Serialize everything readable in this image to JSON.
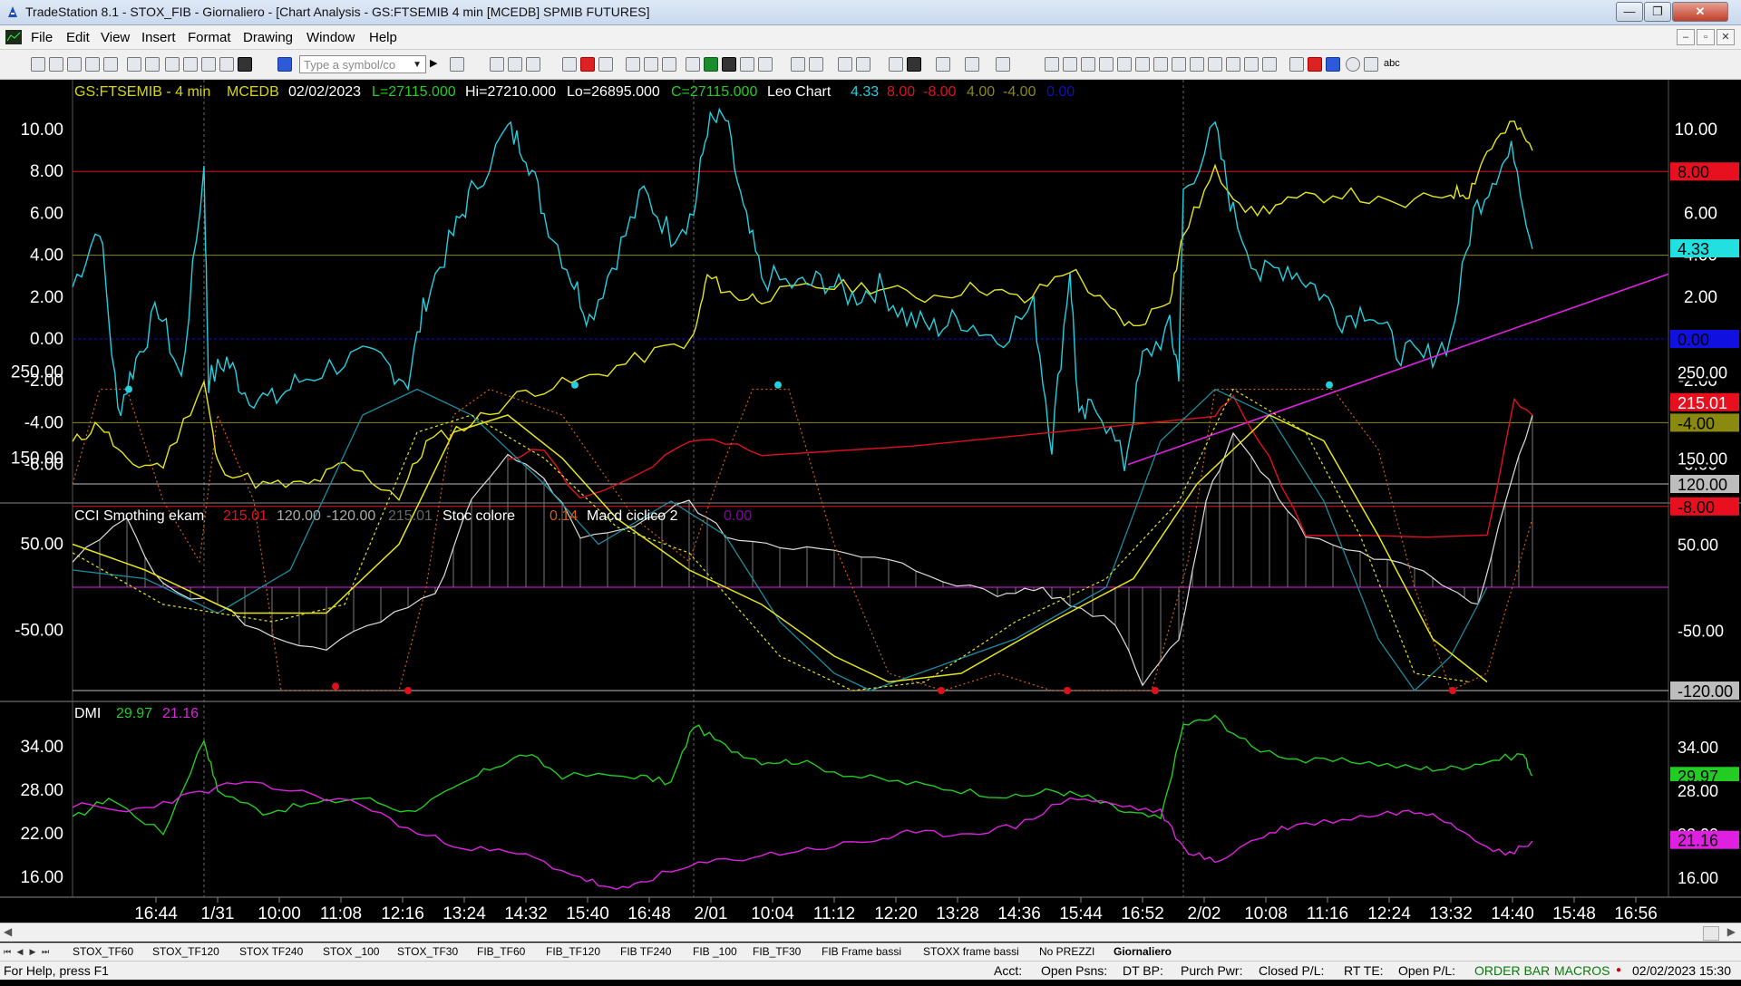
{
  "window": {
    "title": "TradeStation 8.1 - STOX_FIB - Giornaliero - [Chart Analysis - GS:FTSEMIB  4 min  [MCEDB] SPMIB FUTURES]",
    "min_label": "—",
    "max_label": "❐",
    "close_label": "✕"
  },
  "menu": [
    "File",
    "Edit",
    "View",
    "Insert",
    "Format",
    "Drawing",
    "Window",
    "Help"
  ],
  "mdi_buttons": [
    "–",
    "▫",
    "✕"
  ],
  "toolbar": {
    "symbol_placeholder": "Type a symbol/co",
    "text_tool": "abc"
  },
  "chart": {
    "header": {
      "symbol": "GS:FTSEMIB - 4 min",
      "provider": "MCEDB",
      "date": "02/02/2023",
      "last": "L=27115.000",
      "high": "Hi=27210.000",
      "low": "Lo=26895.000",
      "close": "C=27115.000",
      "indicator": "Leo Chart",
      "v1": "4.33",
      "v2": "8.00",
      "v3": "-8.00",
      "v4": "4.00",
      "v5": "-4.00",
      "v6": "0.00"
    },
    "panel2_header": {
      "name": "CCI Smothing ekam",
      "v1": "215.01",
      "v2": "120.00",
      "v3": "-120.00",
      "v4": "215.01",
      "stoc": "Stoc colore",
      "stoc_v": "0.14",
      "macd": "Macd ciclico 2",
      "macd_v": "0.00"
    },
    "panel3_header": {
      "name": "DMI",
      "v1": "29.97",
      "v2": "21.16"
    },
    "panel1_axis": [
      "10.00",
      "8.00",
      "6.00",
      "4.00",
      "2.00",
      "0.00",
      "-2.00",
      "-4.00",
      "-6.00"
    ],
    "panel2_axis": [
      "250.00",
      "150.00",
      "50.00",
      "-50.00"
    ],
    "panel3_axis": [
      "34.00",
      "28.00",
      "22.00",
      "16.00"
    ],
    "right_markers_p1": [
      {
        "label": "8.00",
        "color": "#e8101e",
        "text": "#000"
      },
      {
        "label": "4.33",
        "color": "#22e0e0",
        "text": "#000"
      },
      {
        "label": "0.00",
        "color": "#1010e0",
        "text": "#000"
      },
      {
        "label": "-4.00",
        "color": "#8a8a10",
        "text": "#000"
      },
      {
        "label": "-8.00",
        "color": "#e8101e",
        "text": "#000"
      }
    ],
    "right_markers_p2": [
      {
        "label": "250.00",
        "color": "#000",
        "text": "#fff"
      },
      {
        "label": "215.01",
        "color": "#e8101e",
        "text": "#fff"
      },
      {
        "label": "150.00",
        "color": "#000",
        "text": "#fff"
      },
      {
        "label": "120.00",
        "color": "#bdbdbd",
        "text": "#000"
      },
      {
        "label": "50.00",
        "color": "#000",
        "text": "#fff"
      },
      {
        "label": "-50.00",
        "color": "#000",
        "text": "#fff"
      },
      {
        "label": "-120.00",
        "color": "#bdbdbd",
        "text": "#000"
      }
    ],
    "right_markers_p3": [
      {
        "label": "34.00",
        "color": "#000",
        "text": "#fff"
      },
      {
        "label": "29.97",
        "color": "#22cc22",
        "text": "#000"
      },
      {
        "label": "28.00",
        "color": "#000",
        "text": "#fff"
      },
      {
        "label": "22.00",
        "color": "#000",
        "text": "#fff"
      },
      {
        "label": "21.16",
        "color": "#e020e0",
        "text": "#000"
      },
      {
        "label": "16.00",
        "color": "#000",
        "text": "#fff"
      }
    ],
    "time_axis": [
      "16:44",
      "1/31",
      "10:00",
      "11:08",
      "12:16",
      "13:24",
      "14:32",
      "15:40",
      "16:48",
      "2/01",
      "10:04",
      "11:12",
      "12:20",
      "13:28",
      "14:36",
      "15:44",
      "16:52",
      "2/02",
      "10:08",
      "11:16",
      "12:24",
      "13:32",
      "14:40",
      "15:48",
      "16:56"
    ],
    "colors": {
      "cyan": "#22d0e0",
      "yellow": "#e6e61a",
      "red": "#e0101e",
      "olive": "#8a8a10",
      "blue": "#1010c0",
      "magenta": "#e020e0",
      "green": "#22cc22",
      "orange": "#d06010",
      "grey": "#c8c8c8",
      "teal": "#1a8ca0"
    }
  },
  "tabs": [
    "STOX_TF60",
    "STOX_TF120",
    "STOX TF240",
    "STOX _100",
    "STOX_TF30",
    "FIB_TF60",
    "FIB_TF120",
    "FIB TF240",
    "FIB _100",
    "FIB_TF30",
    "FIB Frame bassi",
    "STOXX frame bassi",
    "No PREZZI",
    "Giornaliero"
  ],
  "status": {
    "help": "For Help, press F1",
    "acct": "Acct:",
    "open_psns": "Open Psns:",
    "dt_bp": "DT BP:",
    "purch_pwr": "Purch Pwr:",
    "closed_pl": "Closed P/L:",
    "rt_te": "RT TE:",
    "open_pl": "Open P/L:",
    "order_bar": "ORDER BAR",
    "macros": "MACROS",
    "datetime": "02/02/2023 15:30"
  }
}
